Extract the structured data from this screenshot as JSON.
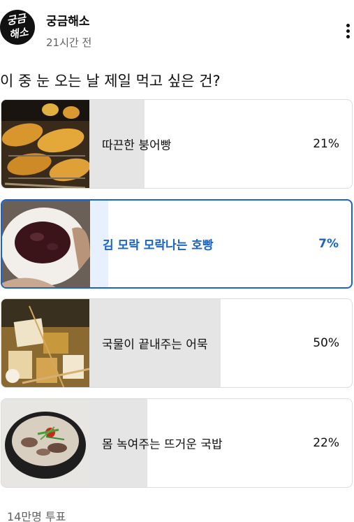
{
  "channel": {
    "name": "궁금해소",
    "avatar_text_line1": "궁금",
    "avatar_text_line2": "해소",
    "time": "21시간 전"
  },
  "poll": {
    "question": "이 중 눈 오는 날 제일 먹고 싶은 건?",
    "options": [
      {
        "label": "따끈한 붕어빵",
        "percent_text": "21%",
        "percent": 21,
        "selected": false,
        "image": "bungeoppang-photo"
      },
      {
        "label": "김 모락 모락나는 호빵",
        "percent_text": "7%",
        "percent": 7,
        "selected": true,
        "image": "hoppang-photo"
      },
      {
        "label": "국물이 끝내주는 어묵",
        "percent_text": "50%",
        "percent": 50,
        "selected": false,
        "image": "eomuk-photo"
      },
      {
        "label": "몸 녹여주는 뜨거운 국밥",
        "percent_text": "22%",
        "percent": 22,
        "selected": false,
        "image": "gukbap-photo"
      }
    ],
    "votes": "14만명 투표"
  },
  "colors": {
    "accent": "#1a64c8",
    "bar": "#e5e5e5",
    "selected_bar": "#e6f1fd",
    "muted_text": "#606060"
  }
}
